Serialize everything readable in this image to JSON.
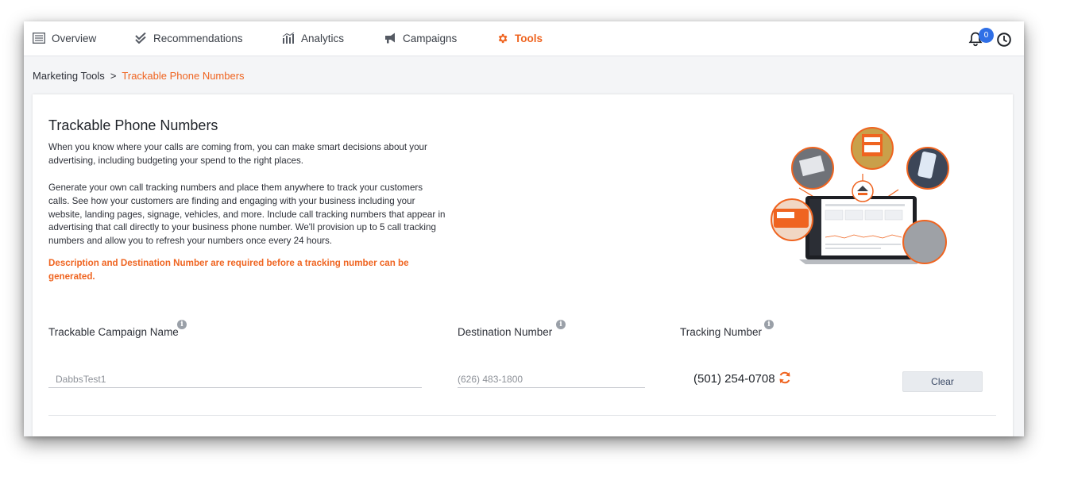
{
  "nav": {
    "items": [
      {
        "label": "Overview",
        "icon": "list-icon"
      },
      {
        "label": "Recommendations",
        "icon": "double-check-icon"
      },
      {
        "label": "Analytics",
        "icon": "bar-chart-icon"
      },
      {
        "label": "Campaigns",
        "icon": "megaphone-icon"
      },
      {
        "label": "Tools",
        "icon": "gear-icon",
        "active": true
      }
    ],
    "notifications_count": "0"
  },
  "breadcrumb": {
    "parent": "Marketing Tools",
    "separator": ">",
    "current": "Trackable Phone Numbers"
  },
  "card": {
    "title": "Trackable Phone Numbers",
    "para1": "When you know where your calls are coming from, you can make smart decisions about your advertising, including budgeting your spend to the right places.",
    "para2": "Generate your own call tracking numbers and place them anywhere to track your customers calls. See how your customers are finding and engaging with your business including your website, landing pages, signage, vehicles, and more. Include call tracking numbers that appear in advertising that call directly to your business phone number. We'll provision up to 5 call tracking numbers and allow you to refresh your numbers once every 24 hours.",
    "warning": "Description and Destination Number are required before a tracking number can be generated."
  },
  "form": {
    "campaign_label": "Trackable Campaign Name",
    "destination_label": "Destination Number",
    "tracking_label": "Tracking Number",
    "campaign_value": "DabbsTest1",
    "destination_value": "(626) 483-1800",
    "tracking_value": "(501) 254-0708",
    "clear_label": "Clear"
  },
  "colors": {
    "accent": "#ef6420",
    "badge": "#2f6fe6"
  }
}
